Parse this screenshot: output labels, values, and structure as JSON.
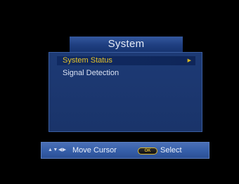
{
  "window": {
    "title": "System"
  },
  "menu": {
    "items": [
      {
        "label": "System Status",
        "selected": true,
        "has_submenu": true
      },
      {
        "label": "Signal Detection",
        "selected": false,
        "has_submenu": false
      }
    ]
  },
  "help_bar": {
    "arrows_icon": "▲▼◀▶",
    "move_label": "Move Cursor",
    "ok_badge": "OK",
    "select_label": "Select"
  },
  "colors": {
    "panel": "#1d3a75",
    "highlight_text": "#e3c12a",
    "help_bar": "#355ea8",
    "background": "#000000"
  }
}
